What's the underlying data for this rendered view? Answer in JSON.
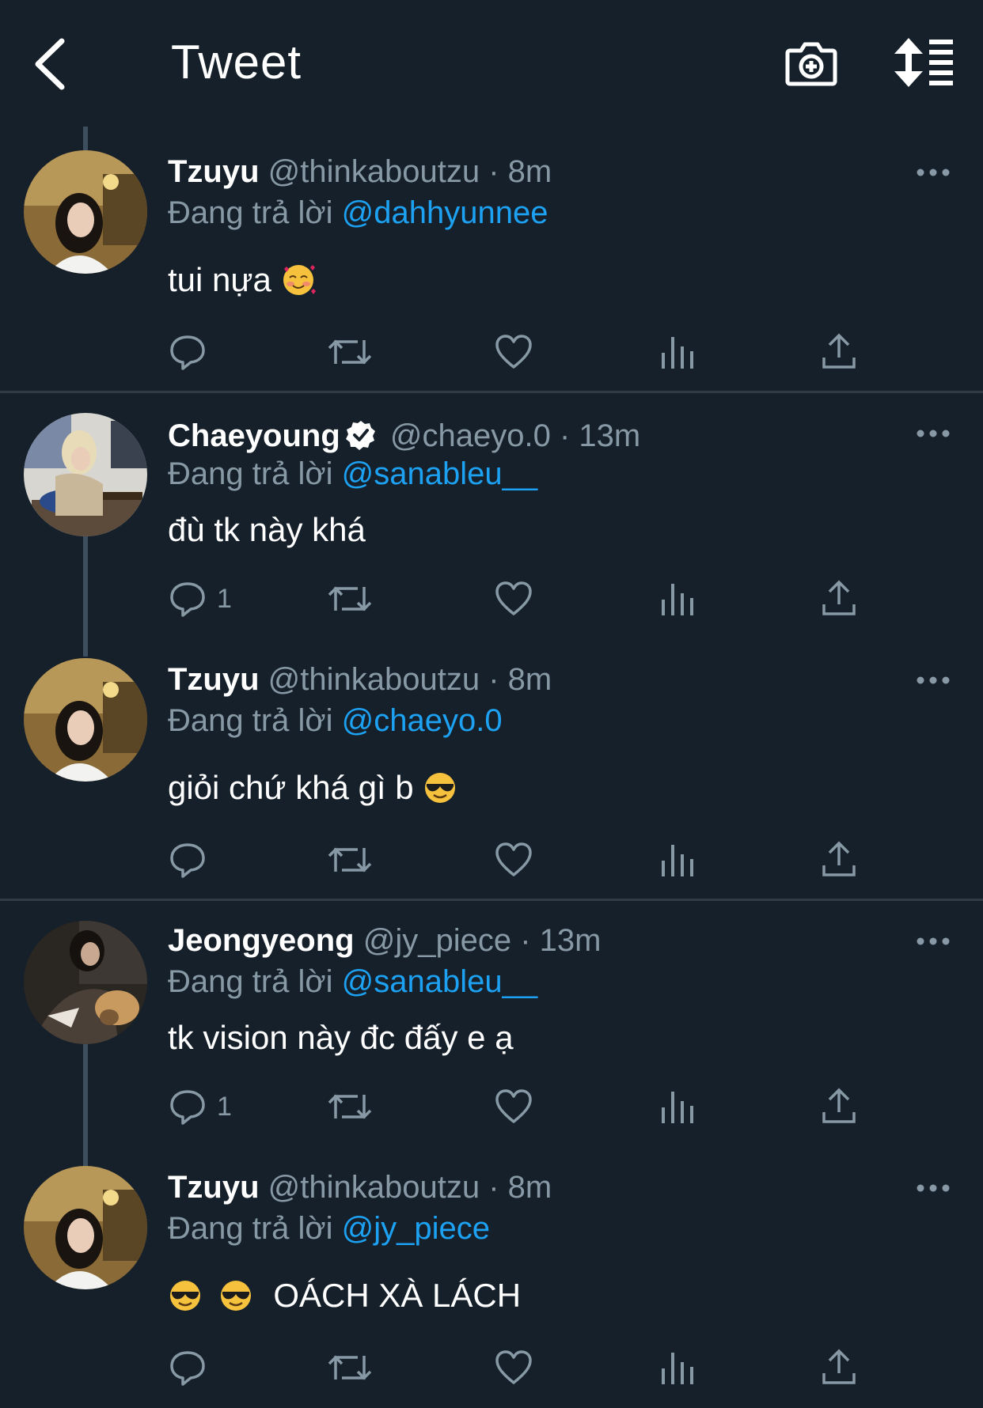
{
  "header": {
    "title": "Tweet"
  },
  "tweets": [
    {
      "name": "Tzuyu",
      "handle": "@thinkaboutzu",
      "time": "· 8m",
      "reply_prefix": "Đang trả lời",
      "reply_to": "@dahhyunnee",
      "text": "tui nựa",
      "emojis": [
        "smiling-face-with-hearts"
      ],
      "reply_count": ""
    },
    {
      "name": "Chaeyoung",
      "verified": true,
      "handle": "@chaeyo.0",
      "time": "· 13m",
      "reply_prefix": "Đang trả lời",
      "reply_to": "@sanableu__",
      "text": "đù tk này khá",
      "reply_count": "1"
    },
    {
      "name": "Tzuyu",
      "handle": "@thinkaboutzu",
      "time": "· 8m",
      "reply_prefix": "Đang trả lời",
      "reply_to": "@chaeyo.0",
      "text": "giỏi chứ khá gì b",
      "emojis": [
        "sunglasses-face"
      ],
      "reply_count": ""
    },
    {
      "name": "Jeongyeong",
      "handle": "@jy_piece",
      "time": "· 13m",
      "reply_prefix": "Đang trả lời",
      "reply_to": "@sanableu__",
      "text": "tk vision này đc đấy e ạ",
      "reply_count": "1"
    },
    {
      "name": "Tzuyu",
      "handle": "@thinkaboutzu",
      "time": "· 8m",
      "reply_prefix": "Đang trả lời",
      "reply_to": "@jy_piece",
      "text": "OÁCH XÀ LÁCH",
      "emojis": [
        "sunglasses-face",
        "sunglasses-face"
      ],
      "reply_count": ""
    }
  ],
  "colors": {
    "background": "#16202b",
    "mention": "#1da1f2",
    "secondary_text": "#8899a6",
    "divider": "#2f3c48"
  },
  "icons": {
    "header": [
      "back-arrow-icon",
      "camera-plus-icon",
      "sort-list-icon"
    ],
    "actions": [
      "reply-icon",
      "retweet-icon",
      "like-icon",
      "analytics-icon",
      "share-icon"
    ],
    "more": "more-dots-icon"
  }
}
